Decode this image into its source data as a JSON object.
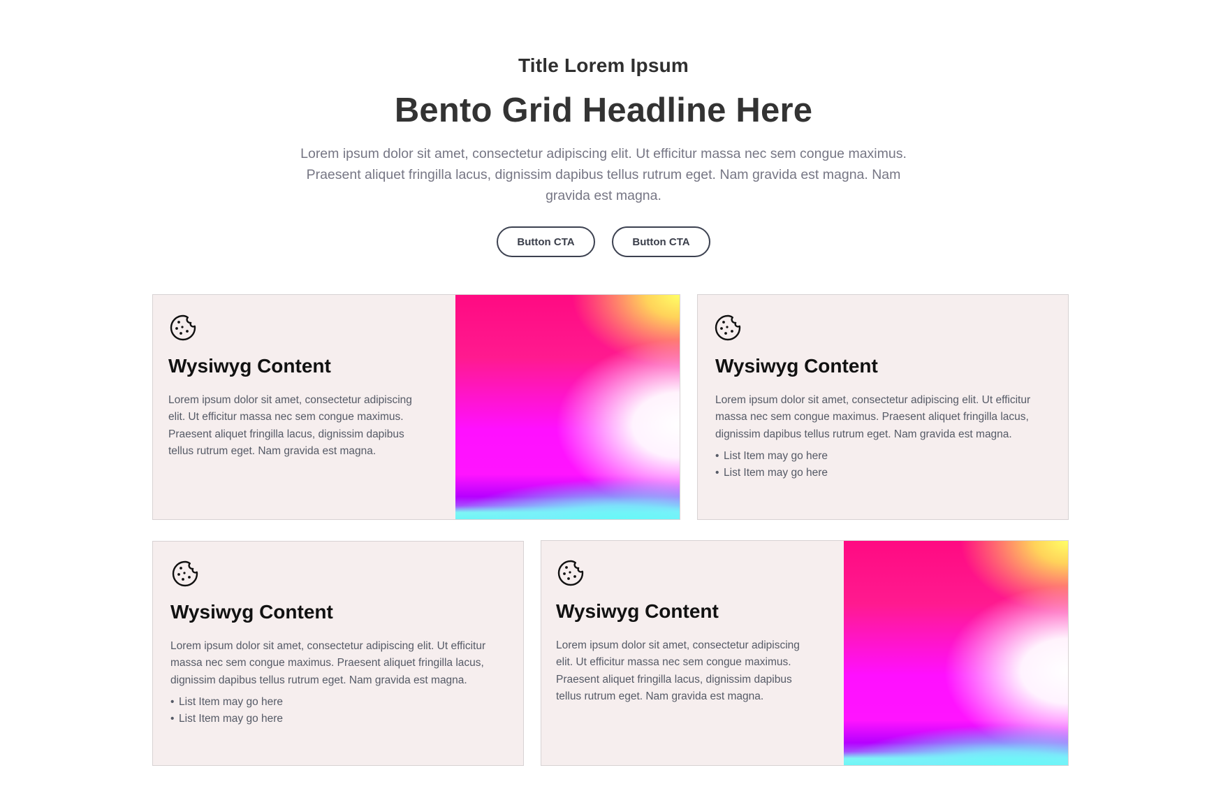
{
  "hero": {
    "eyebrow": "Title Lorem Ipsum",
    "headline": "Bento Grid Headline Here",
    "intro": "Lorem ipsum dolor sit amet, consectetur adipiscing elit. Ut efficitur massa nec sem congue maximus. Praesent aliquet fringilla lacus, dignissim dapibus tellus rutrum eget. Nam gravida est magna. Nam gravida est magna.",
    "cta_primary": "Button CTA",
    "cta_secondary": "Button CTA"
  },
  "cards": [
    {
      "icon": "cookie-icon",
      "title": "Wysiwyg Content",
      "text": "Lorem ipsum dolor sit amet, consectetur adipiscing elit. Ut efficitur massa nec sem congue maximus. Praesent aliquet fringilla lacus, dignissim dapibus tellus rutrum eget. Nam gravida est magna.",
      "has_image": true
    },
    {
      "icon": "cookie-icon",
      "title": "Wysiwyg Content",
      "text": "Lorem ipsum dolor sit amet, consectetur adipiscing elit. Ut efficitur massa nec sem congue maximus. Praesent aliquet fringilla lacus, dignissim dapibus tellus rutrum eget. Nam gravida est magna.",
      "list": [
        "List Item may go here",
        "List Item may go here"
      ]
    },
    {
      "icon": "cookie-icon",
      "title": "Wysiwyg Content",
      "text": "Lorem ipsum dolor sit amet, consectetur adipiscing elit. Ut efficitur massa nec sem congue maximus. Praesent aliquet fringilla lacus, dignissim dapibus tellus rutrum eget. Nam gravida est magna.",
      "list": [
        "List Item may go here",
        "List Item may go here"
      ]
    },
    {
      "icon": "cookie-icon",
      "title": "Wysiwyg Content",
      "text": "Lorem ipsum dolor sit amet, consectetur adipiscing elit. Ut efficitur massa nec sem congue maximus. Praesent aliquet fringilla lacus, dignissim dapibus tellus rutrum eget. Nam gravida est magna.",
      "has_image": true
    }
  ],
  "colors": {
    "card_background": "#f6eeee",
    "card_border": "#d7d2d3",
    "button_border": "#3c4150",
    "intro_text": "#767684",
    "body_text": "#555a66",
    "gradient_pink": "#ff0a82",
    "gradient_magenta": "#ff14ff",
    "gradient_yellow": "#ffff66",
    "gradient_cyan": "#6cf7f5"
  }
}
